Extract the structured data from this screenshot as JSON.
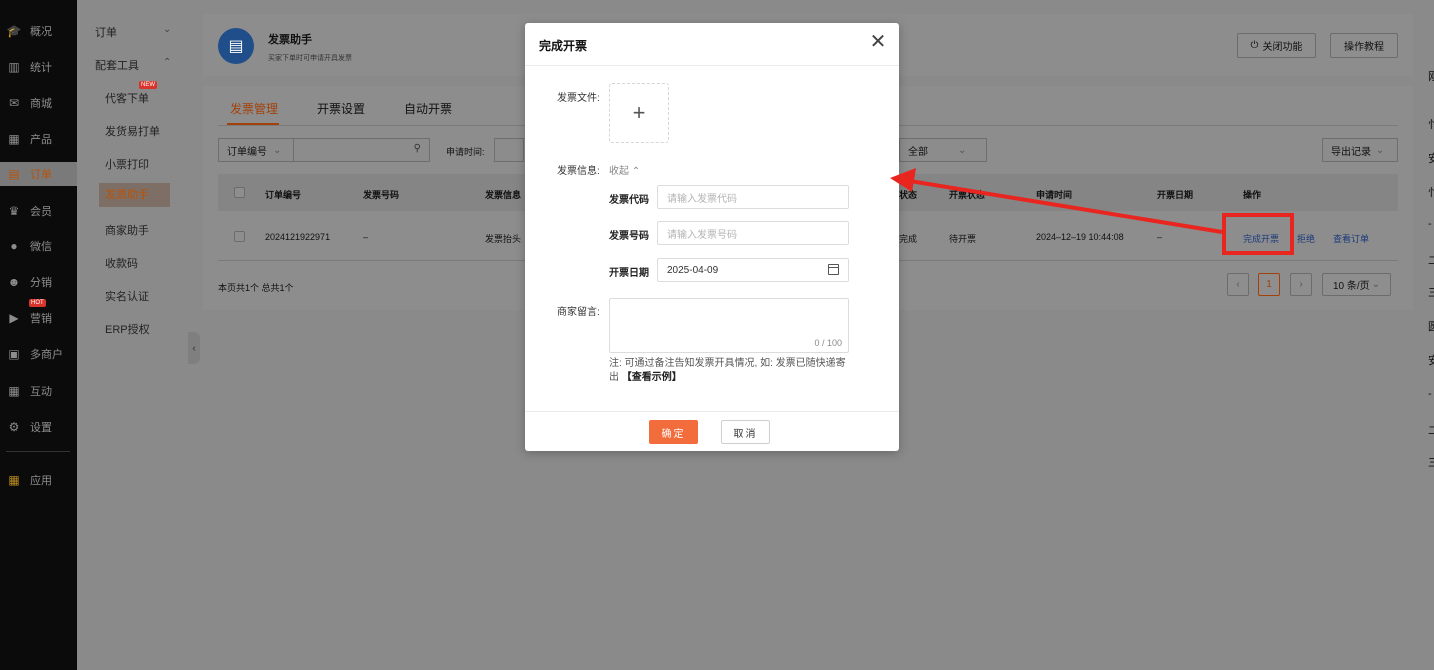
{
  "nav": {
    "items": [
      {
        "label": "概况",
        "icon": "graduation-cap-icon"
      },
      {
        "label": "统计",
        "icon": "chart-icon"
      },
      {
        "label": "商城",
        "icon": "store-icon"
      },
      {
        "label": "产品",
        "icon": "grid-icon"
      },
      {
        "label": "订单",
        "icon": "clipboard-icon"
      },
      {
        "label": "会员",
        "icon": "crown-icon"
      },
      {
        "label": "微信",
        "icon": "wechat-icon"
      },
      {
        "label": "分销",
        "icon": "users-icon"
      },
      {
        "label": "营销",
        "icon": "flag-icon"
      },
      {
        "label": "多商户",
        "icon": "shop-icon"
      },
      {
        "label": "互动",
        "icon": "apps-icon"
      },
      {
        "label": "设置",
        "icon": "gear-icon"
      },
      {
        "label": "应用",
        "icon": "apps-color-icon"
      }
    ],
    "hot_tag": "HOT"
  },
  "submenu": {
    "group1": "订单",
    "group2": "配套工具",
    "items": [
      "代客下单",
      "发货易打单",
      "小票打印",
      "发票助手",
      "商家助手",
      "收款码",
      "实名认证",
      "ERP授权"
    ],
    "new_tag": "NEW"
  },
  "header": {
    "title": "发票助手",
    "subtitle": "买家下单时可申请开具发票",
    "close_feature": "关闭功能",
    "tutorial": "操作教程"
  },
  "tabs": [
    "发票管理",
    "开票设置",
    "自动开票"
  ],
  "filters": {
    "order_no": "订单编号",
    "apply_time": "申请时间:",
    "status_all": "全部",
    "export": "导出记录"
  },
  "table": {
    "headers": [
      "订单编号",
      "发票号码",
      "发票信息",
      "状态",
      "开票状态",
      "申请时间",
      "开票日期",
      "操作"
    ],
    "rows": [
      {
        "order_no": "2024121922971",
        "invoice_no": "–",
        "invoice_info": "发票抬头",
        "status": "完成",
        "invoice_status": "待开票",
        "apply_time": "2024–12–19 10:44:08",
        "invoice_date": "–",
        "actions": [
          "完成开票",
          "拒绝",
          "查看订单"
        ]
      }
    ],
    "summary": "本页共1个 总共1个",
    "page": "1",
    "page_size": "10 条/页"
  },
  "right_edge_chars": [
    "刚",
    "忄",
    "安",
    "忄",
    "-",
    "二",
    "三",
    "圆",
    "安",
    "-",
    "二",
    "三"
  ],
  "modal": {
    "title": "完成开票",
    "file_label": "发票文件:",
    "info_label": "发票信息:",
    "collapse": "收起",
    "code_label": "发票代码",
    "code_placeholder": "请输入发票代码",
    "number_label": "发票号码",
    "number_placeholder": "请输入发票号码",
    "date_label": "开票日期",
    "date_value": "2025-04-09",
    "message_label": "商家留言:",
    "counter": "0 / 100",
    "note": "注: 可通过备注告知发票开具情况, 如: 发票已随快递寄出",
    "example": "【查看示例】",
    "ok": "确定",
    "cancel": "取消"
  },
  "colors": {
    "accent": "#f36d3c",
    "highlight": "#e8251f",
    "link": "#1d3a7a"
  }
}
